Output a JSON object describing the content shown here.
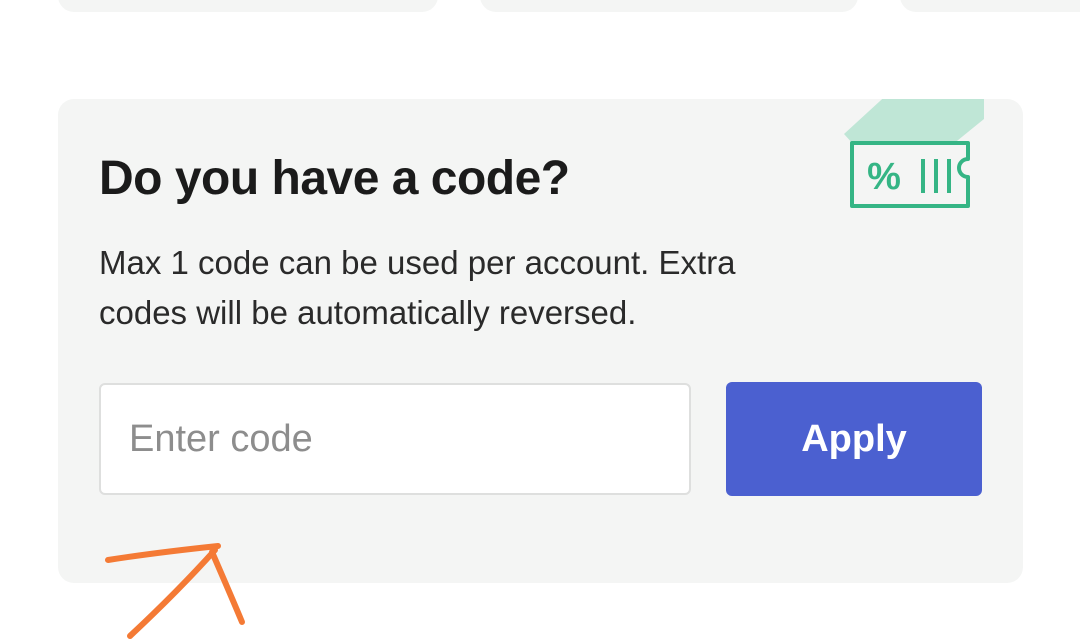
{
  "promo": {
    "title": "Do you have a code?",
    "description": "Max 1 code can be used per account. Extra codes will be automatically reversed.",
    "input_placeholder": "Enter code",
    "input_value": "",
    "apply_label": "Apply",
    "ticket_symbol": "%"
  },
  "colors": {
    "accent": "#4b60d0",
    "icon": "#35b585",
    "icon_fill": "#bfe6d6",
    "card_bg": "#f4f5f4",
    "annotation": "#f47a35"
  },
  "icons": [
    "ticket-percent-icon"
  ]
}
